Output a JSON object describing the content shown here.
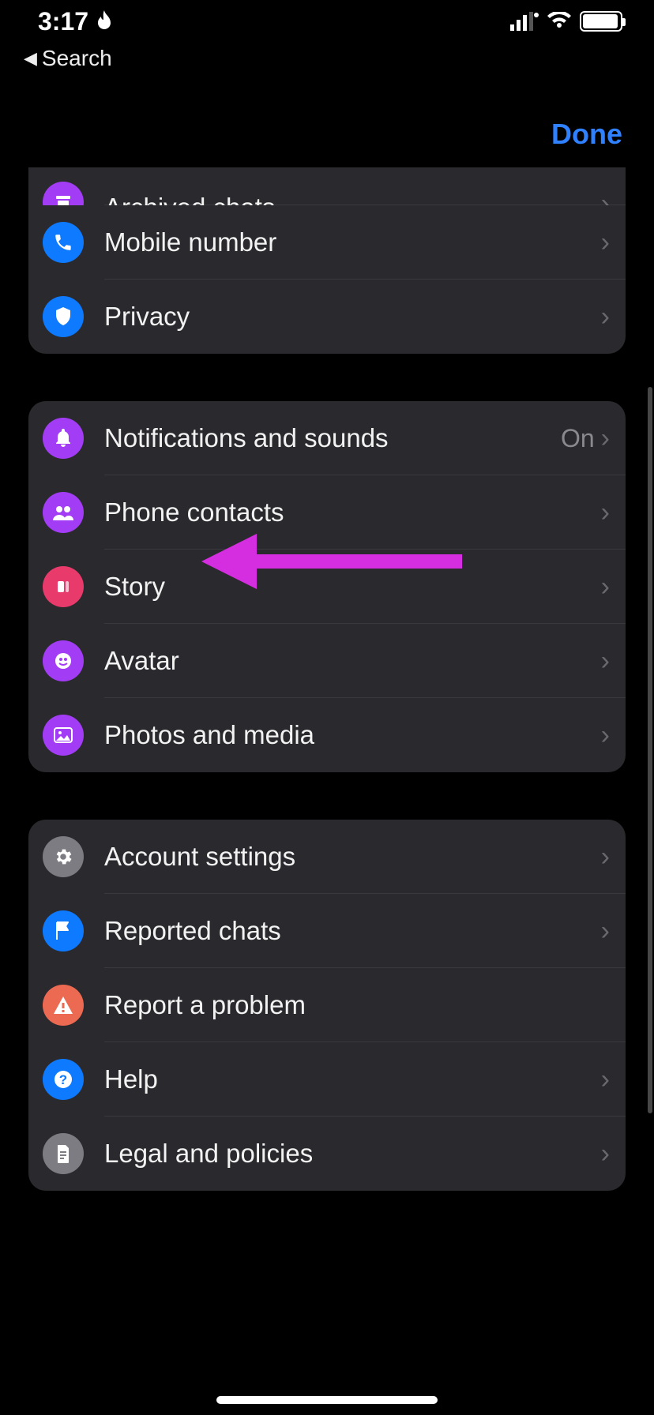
{
  "status": {
    "time": "3:17",
    "back_label": "Search"
  },
  "sheet": {
    "done": "Done"
  },
  "section1": {
    "archived": "Archived chats",
    "mobile": "Mobile number",
    "privacy": "Privacy"
  },
  "section2": {
    "notifications": {
      "label": "Notifications and sounds",
      "value": "On"
    },
    "contacts": "Phone contacts",
    "story": "Story",
    "avatar": "Avatar",
    "photos": "Photos and media"
  },
  "section3": {
    "account": "Account settings",
    "reported": "Reported chats",
    "report": "Report a problem",
    "help": "Help",
    "legal": "Legal and policies"
  }
}
